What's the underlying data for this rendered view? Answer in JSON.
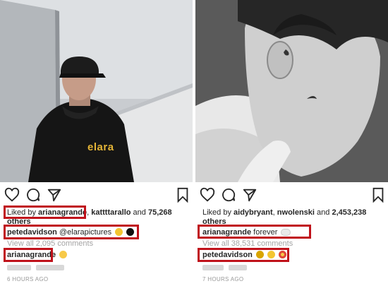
{
  "left_post": {
    "brand_on_hoodie": "elara",
    "likes_prefix": "Liked by ",
    "likes_user1": "arianagrande",
    "likes_sep": ", ",
    "likes_user2": "kattttarallo",
    "likes_and": " and ",
    "likes_count": "75,268",
    "likes_others": "others",
    "caption_user": "petedavidson",
    "caption_text": "@elarapictures",
    "view_comments": "View all 2,095 comments",
    "comment_user": "arianagrande",
    "timestamp": "6 HOURS AGO"
  },
  "right_post": {
    "likes_prefix": "Liked by ",
    "likes_user1": "aidybryant",
    "likes_sep": ", ",
    "likes_user2": "nwolenski",
    "likes_and": " and ",
    "likes_count": "2,453,238",
    "likes_others": "others",
    "caption_user": "arianagrande",
    "caption_text": "forever",
    "view_comments": "View all 38,531 comments",
    "comment_user": "petedavidson",
    "timestamp": "7 HOURS AGO"
  },
  "icons": [
    "heart-icon",
    "comment-icon",
    "share-icon",
    "bookmark-icon",
    "yellow-heart-emoji",
    "black-heart-emoji",
    "cloud-emoji",
    "bee-emoji",
    "heart-eyes-emoji",
    "smile-emoji"
  ],
  "colors": {
    "highlight": "#c0121b",
    "text": "#262626",
    "muted": "#a5a5a5",
    "brand": "#e3b437"
  }
}
